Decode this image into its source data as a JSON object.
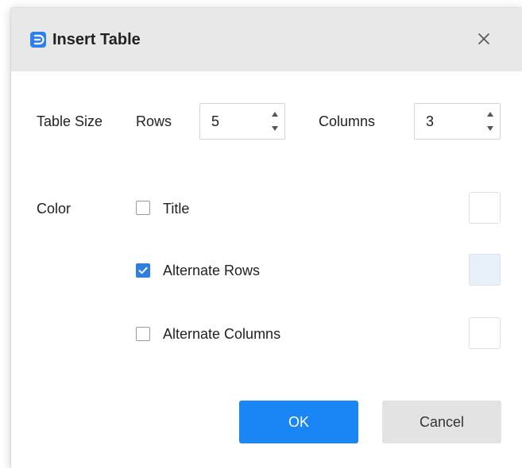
{
  "dialog": {
    "title": "Insert Table",
    "app_icon": "edraw-logo-icon",
    "close_icon": "close-icon"
  },
  "table_size": {
    "section_label": "Table Size",
    "rows_label": "Rows",
    "rows_value": "5",
    "columns_label": "Columns",
    "columns_value": "3"
  },
  "color": {
    "section_label": "Color",
    "options": [
      {
        "label": "Title",
        "checked": false,
        "swatch_color": "#ffffff"
      },
      {
        "label": "Alternate Rows",
        "checked": true,
        "swatch_color": "#e8f1fa"
      },
      {
        "label": "Alternate Columns",
        "checked": false,
        "swatch_color": "#ffffff"
      }
    ]
  },
  "buttons": {
    "ok_label": "OK",
    "cancel_label": "Cancel"
  },
  "theme": {
    "accent": "#1a86f5",
    "checkbox_checked": "#2f7fe0",
    "titlebar_bg": "#e8e8e8"
  }
}
